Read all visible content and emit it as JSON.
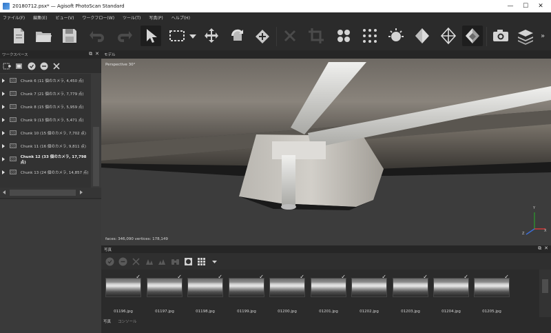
{
  "window": {
    "title": "20180712.psx* — Agisoft PhotoScan Standard",
    "minimize": "—",
    "maximize": "☐",
    "close": "✕"
  },
  "menu": [
    {
      "label": "ファイル(F)"
    },
    {
      "label": "編集(E)"
    },
    {
      "label": "ビュー(V)"
    },
    {
      "label": "ワークフロー(W)"
    },
    {
      "label": "ツール(T)"
    },
    {
      "label": "写真(P)"
    },
    {
      "label": "ヘルプ(H)"
    }
  ],
  "toolbar": {
    "icons": [
      "new-icon",
      "open-icon",
      "save-icon",
      "undo-icon",
      "redo-icon",
      "select-arrow-icon",
      "rectangle-selection-icon",
      "move-object-icon",
      "rotate-object-icon",
      "navigation-icon",
      "delete-icon",
      "crop-icon",
      "point-cloud-icon",
      "dense-cloud-icon",
      "model-shaded-icon",
      "solid-icon",
      "wireframe-icon",
      "textured-icon",
      "camera-icon",
      "layers-icon"
    ],
    "overflow": "»"
  },
  "workspace": {
    "title": "ワークスペース",
    "chunks": [
      {
        "label": "Chunk 6 (11 個のカメラ, 4,450 点)",
        "selected": false
      },
      {
        "label": "Chunk 7 (21 個のカメラ, 7,779 点)",
        "selected": false
      },
      {
        "label": "Chunk 8 (15 個のカメラ, 5,959 点)",
        "selected": false
      },
      {
        "label": "Chunk 9 (13 個のカメラ, 5,471 点)",
        "selected": false
      },
      {
        "label": "Chunk 10 (15 個のカメラ, 7,702 点)",
        "selected": false
      },
      {
        "label": "Chunk 11 (16 個のカメラ, 9,811 点)",
        "selected": false
      },
      {
        "label": "Chunk 12 (33 個のカメラ, 17,798 点)",
        "selected": true
      },
      {
        "label": "Chunk 13 (24 個のカメラ, 14,857 点)",
        "selected": false
      }
    ]
  },
  "model": {
    "tab": "モデル",
    "perspective": "Perspective 30°",
    "stats": "faces: 346,090 vertices: 178,149",
    "axis_y": "Y",
    "axis_z": "Z",
    "axis_x": "X"
  },
  "photos": {
    "title": "写真",
    "items": [
      "01196.jpg",
      "01197.jpg",
      "01198.jpg",
      "01199.jpg",
      "01200.jpg",
      "01201.jpg",
      "01202.jpg",
      "01203.jpg",
      "01204.jpg",
      "01205.jpg"
    ]
  },
  "bottom_tabs": [
    "写真",
    "コンソール"
  ],
  "colors": {
    "background": "#2b2b2b",
    "panel": "#323232",
    "titlebar": "#ffffff",
    "accent_check": "#e6e6e6"
  }
}
